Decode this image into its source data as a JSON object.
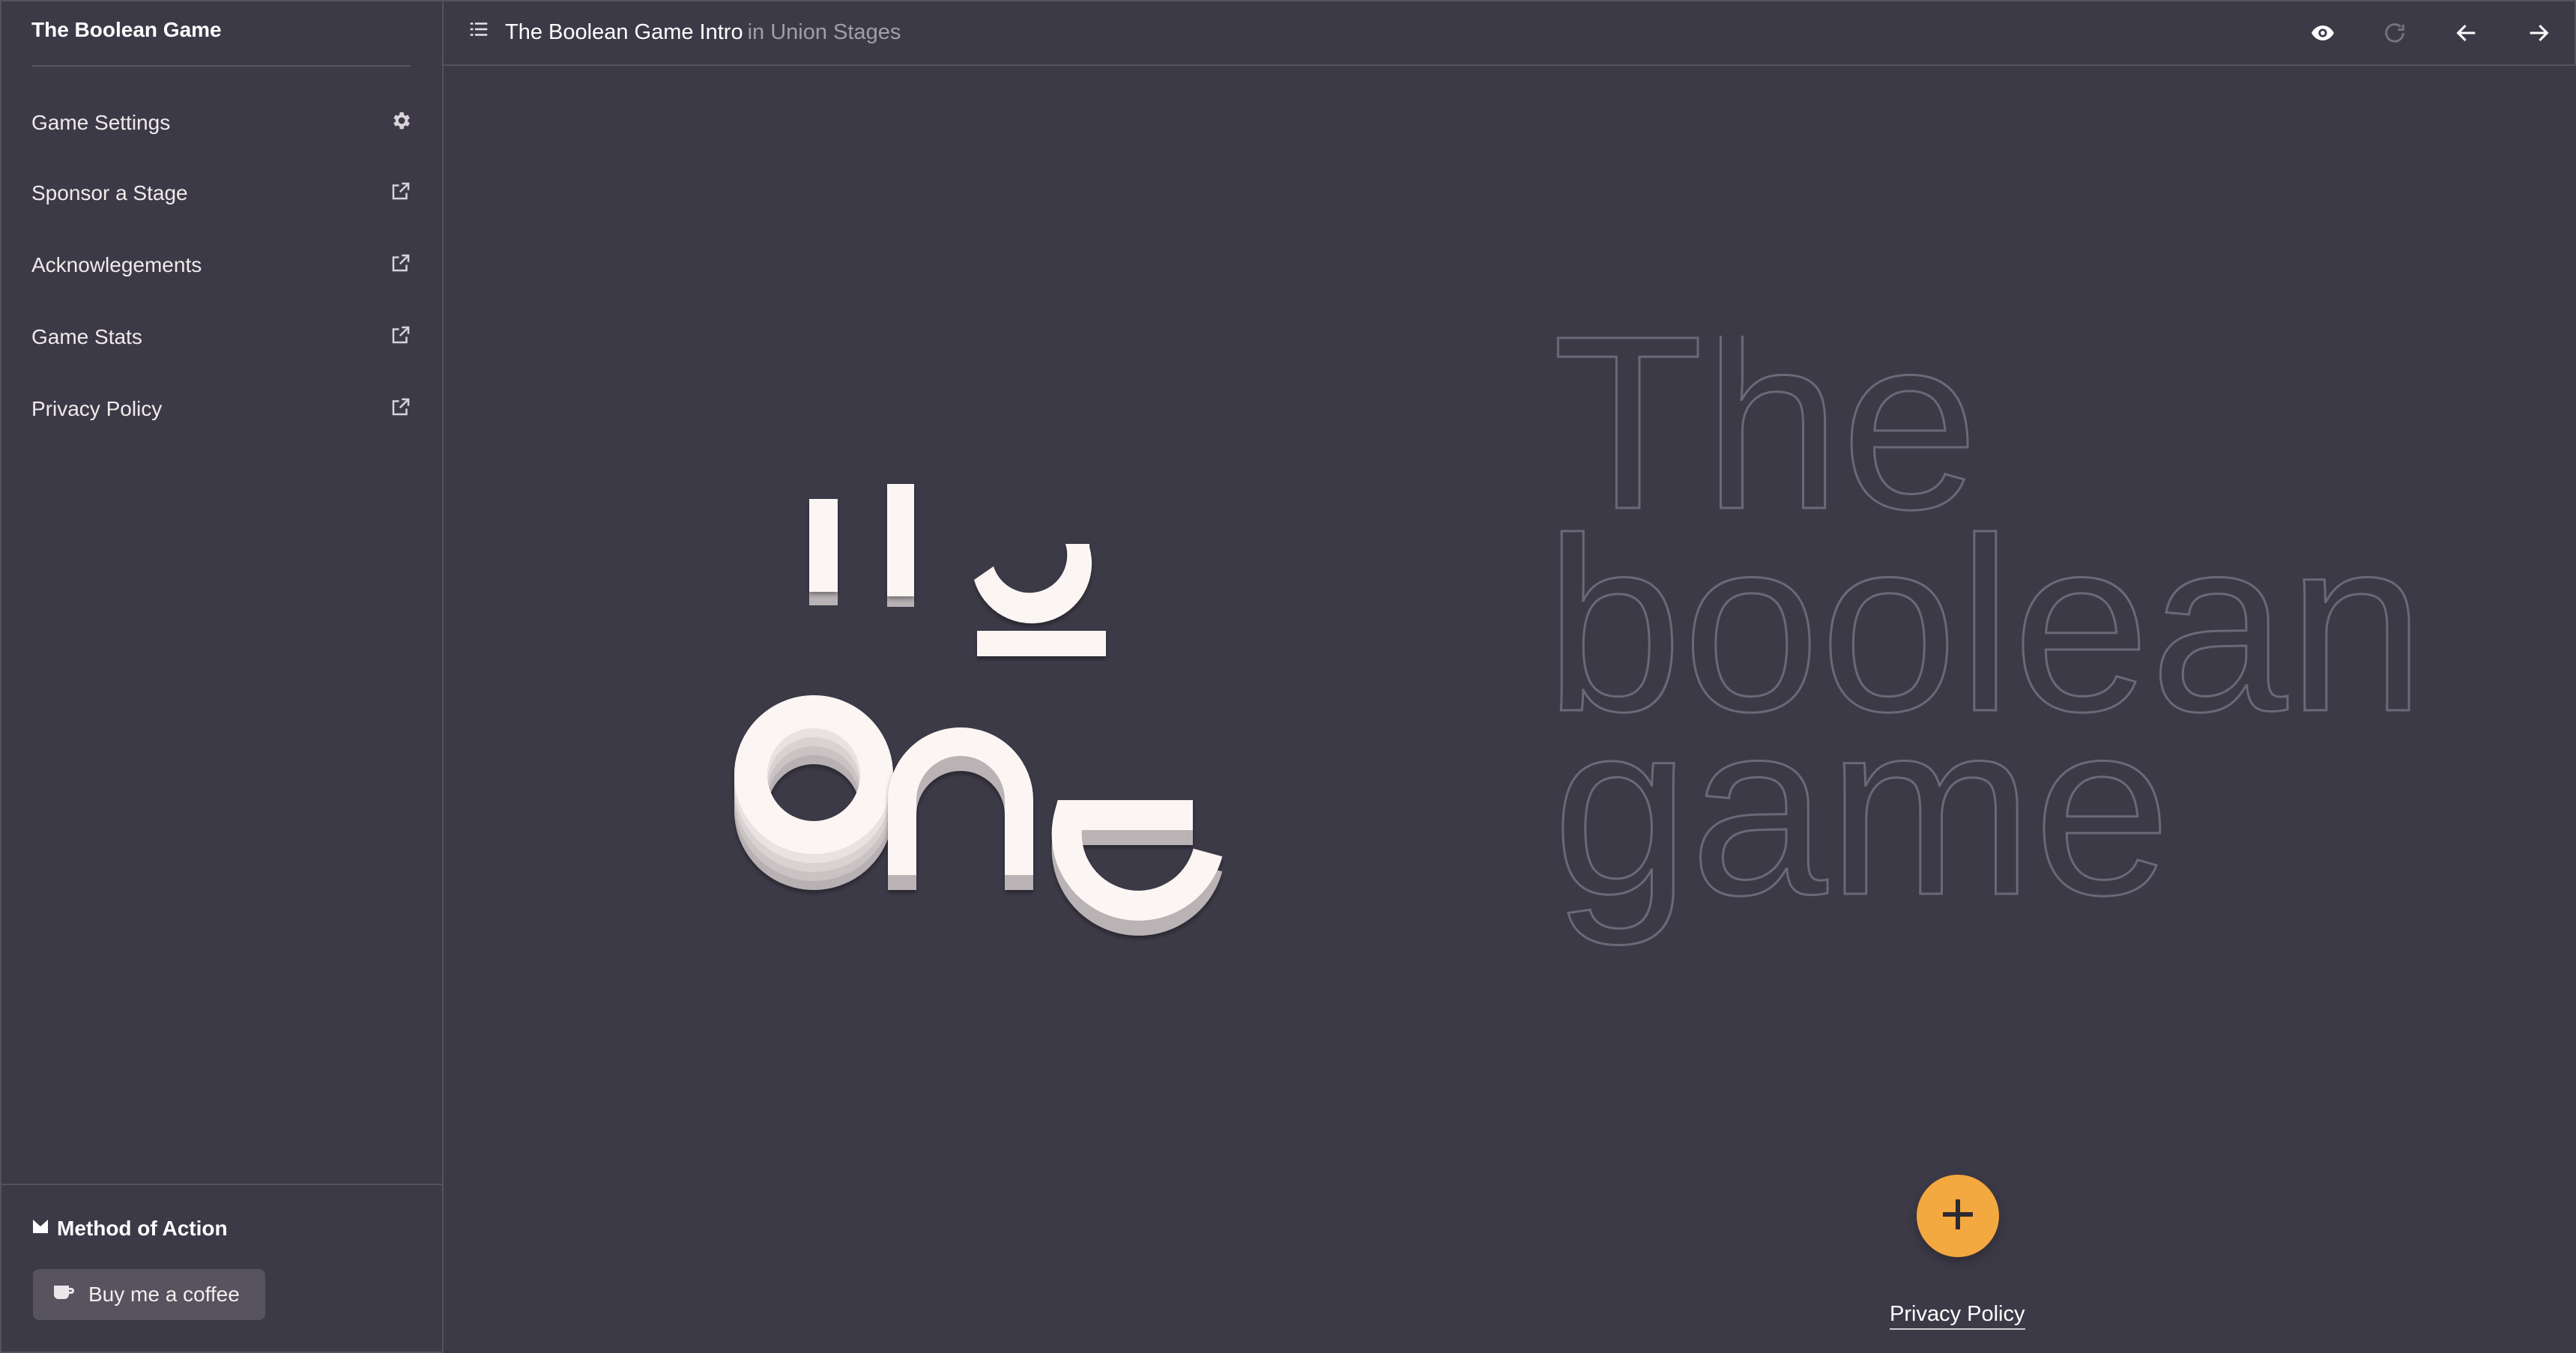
{
  "sidebar": {
    "title": "The Boolean Game",
    "items": [
      {
        "label": "Game Settings",
        "icon": "gear-icon"
      },
      {
        "label": "Sponsor a Stage",
        "icon": "external-link-icon"
      },
      {
        "label": "Acknowlegements",
        "icon": "external-link-icon"
      },
      {
        "label": "Game Stats",
        "icon": "external-link-icon"
      },
      {
        "label": "Privacy Policy",
        "icon": "external-link-icon"
      }
    ],
    "footer_brand": "Method of Action",
    "coffee_label": "Buy me a coffee"
  },
  "topbar": {
    "title": "The Boolean Game Intro",
    "context": "in Union Stages"
  },
  "stage": {
    "intro_word_top": "one",
    "intro_word_bottom": "one",
    "logo_lines": [
      "The",
      "boolean",
      "game"
    ],
    "footer_link": "Privacy Policy"
  },
  "colors": {
    "background": "#3d3a48",
    "accent": "#f4a840",
    "text": "#f4eeee",
    "outline": "#6c6877"
  }
}
